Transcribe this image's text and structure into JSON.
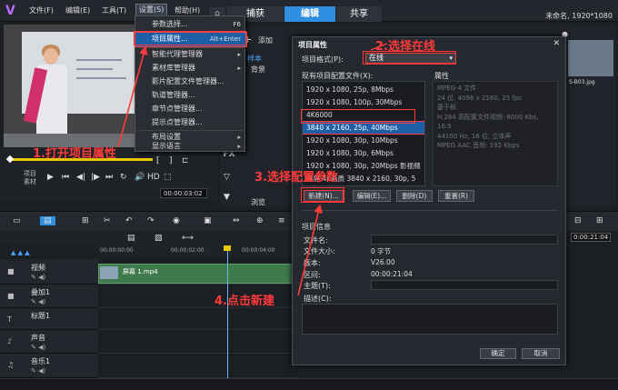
{
  "menubar": {
    "items": [
      "文件(F)",
      "编辑(E)",
      "工具(T)",
      "设置(S)",
      "帮助(H)"
    ],
    "active": "设置(S)"
  },
  "tabs": [
    "捕获",
    "编辑",
    "共享"
  ],
  "selected_tab": "编辑",
  "project_info": "未命名, 1920*1080",
  "settings_menu": {
    "items": [
      {
        "label": "参数选择...",
        "shortcut": "F6"
      },
      {
        "label": "项目属性...",
        "shortcut": "Alt+Enter",
        "highlighted": true
      },
      {
        "label": "智能代理管理器",
        "submenu": true
      },
      {
        "label": "素材库管理器",
        "submenu": true
      },
      {
        "label": "影片配置文件管理器...",
        "submenu": false
      },
      {
        "label": "轨道管理器...",
        "submenu": false
      },
      {
        "label": "章节点管理器...",
        "submenu": false
      },
      {
        "label": "提示点管理器...",
        "submenu": false
      },
      {
        "label": "布局设置",
        "submenu": true
      },
      {
        "label": "显示语言",
        "submenu": true
      }
    ]
  },
  "library": {
    "add_label": "添加",
    "items": [
      "样本",
      "背景"
    ],
    "browse_label": "浏览",
    "fx_label": "FX",
    "thumb_name": "S-B03.jpg"
  },
  "preview": {
    "project_label": "项目",
    "clip_label": "素材",
    "hd_label": "HD",
    "timecode": "00:00:03:02"
  },
  "dialog": {
    "title": "项目属性",
    "format_label": "项目格式(P):",
    "format_value": "在线",
    "existing_label": "现有项目配置文件(X):",
    "properties_label": "属性",
    "profiles": [
      "1920 x 1080, 25p, 8Mbps",
      "1920 x 1080, 100p, 30Mbps",
      "4K6000",
      "3840 x 2160, 25p, 40Mbps",
      "1920 x 1080, 30p, 10Mbps",
      "1920 x 1080, 30p, 6Mbps",
      "1920 x 1080, 30p, 20Mbps 影视频",
      "横屏 4K画质 3840 x 2160, 30p, 5"
    ],
    "selected_profile": 3,
    "properties": [
      "MPEG-4 文件",
      "24 位, 4096 x 2160, 25 fps",
      "基于帧",
      "H.264 高配置文件视频: 6000 Kbs,",
      "16:9",
      "44100 Hz, 16 位, 立体声",
      "MPEG AAC 音频: 192 Kbps"
    ],
    "buttons": [
      "新建(N)...",
      "编辑(E)...",
      "删除(D)",
      "重置(R)"
    ],
    "info_title": "项目信息",
    "info_labels": [
      "文件名:",
      "文件大小:",
      "版本:",
      "区间:",
      "主题(T):",
      "描述(C):"
    ],
    "info_values": {
      "size": "0 字节",
      "version": "V26.00",
      "duration": "00:00:21:04"
    },
    "ok": "确定",
    "cancel": "取消"
  },
  "timeline": {
    "ruler": [
      "00:00:00:00",
      "00:00:02:00",
      "00:00:04:00"
    ],
    "right_timecode": "0:00:21:04",
    "tracks": [
      "视频",
      "叠加1",
      "标题1",
      "声音",
      "音乐1"
    ],
    "clip_name": "屏幕 1.mp4"
  },
  "annotations": {
    "step1": "1.打开项目属性",
    "step2": "2.选择在线",
    "step3": "3.选择配置参数",
    "step4": "4.点击新建"
  },
  "colors": {
    "accent": "#2f8fe0",
    "annotation": "#ff3b3b",
    "clip": "#3f7a4c"
  }
}
